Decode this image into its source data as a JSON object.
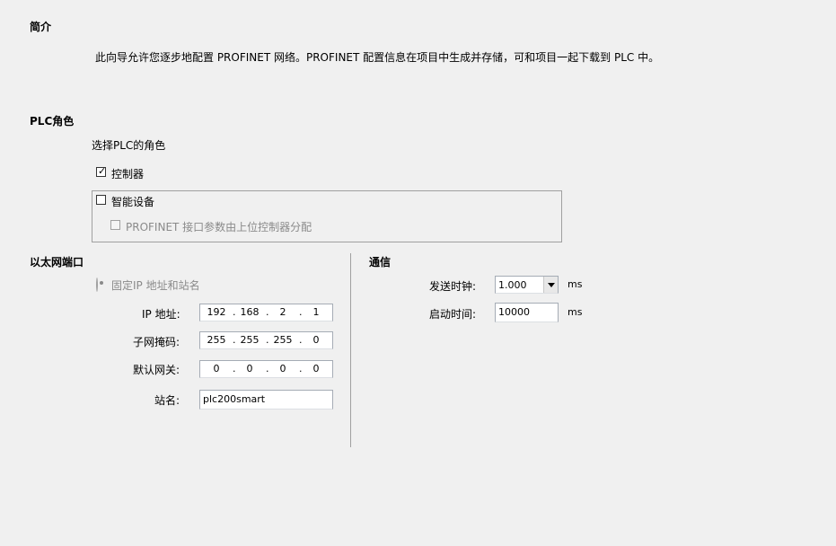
{
  "intro": {
    "heading": "简介",
    "description": "此向导允许您逐步地配置 PROFINET 网络。PROFINET 配置信息在项目中生成并存储，可和项目一起下载到 PLC 中。"
  },
  "plc_role": {
    "heading": "PLC角色",
    "prompt": "选择PLC的角色",
    "controller_label": "控制器",
    "controller_checked": true,
    "smart_device_label": "智能设备",
    "smart_device_checked": false,
    "param_assign_label": "PROFINET 接口参数由上位控制器分配",
    "param_assign_checked": false
  },
  "ethernet_port": {
    "heading": "以太网端口",
    "fixed_ip_label": "固定IP 地址和站名",
    "ip_label": "IP 地址:",
    "ip": [
      "192",
      "168",
      "2",
      "1"
    ],
    "subnet_label": "子网掩码:",
    "subnet": [
      "255",
      "255",
      "255",
      "0"
    ],
    "gateway_label": "默认网关:",
    "gateway": [
      "0",
      "0",
      "0",
      "0"
    ],
    "station_label": "站名:",
    "station_value": "plc200smart"
  },
  "communication": {
    "heading": "通信",
    "send_clock_label": "发送时钟:",
    "send_clock_value": "1.000",
    "send_clock_unit": "ms",
    "startup_label": "启动时间:",
    "startup_value": "10000",
    "startup_unit": "ms"
  }
}
